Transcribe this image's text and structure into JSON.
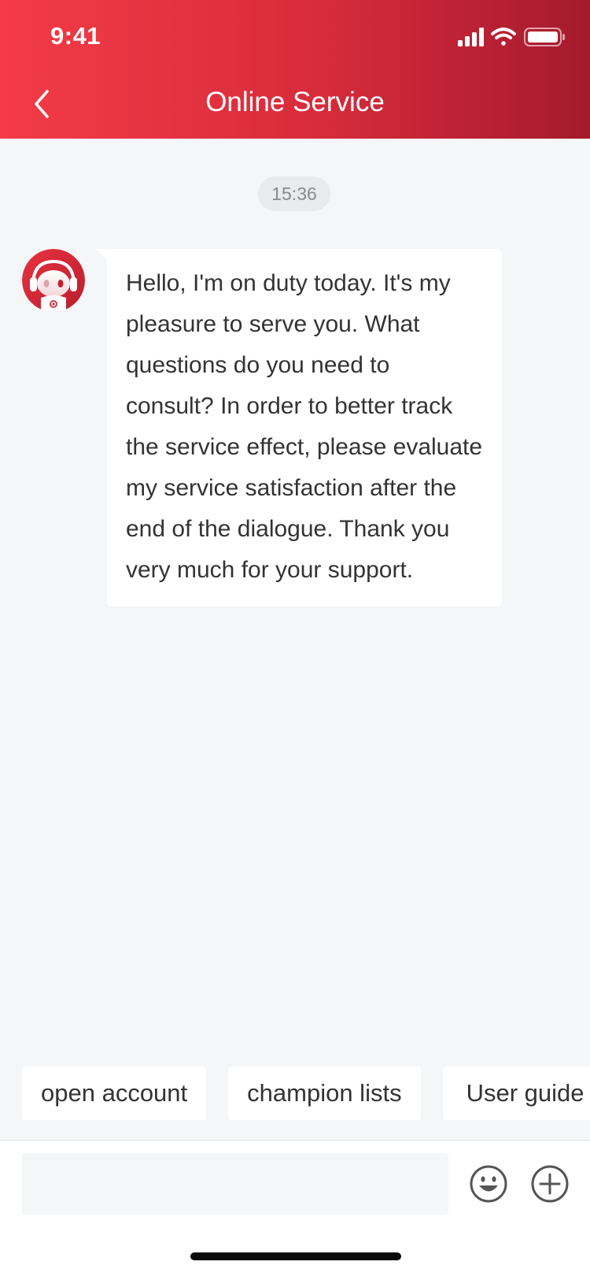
{
  "status_bar": {
    "time": "9:41"
  },
  "header": {
    "title": "Online Service"
  },
  "chat": {
    "timestamp": "15:36",
    "messages": [
      {
        "sender": "agent",
        "text": "Hello, I'm on duty today. It's my pleasure to serve you. What questions do you need to consult? In order to better track the service effect, please evaluate my service satisfaction after the end of the dialogue. Thank you very much for your support."
      }
    ]
  },
  "quick_replies": [
    {
      "label": "open account"
    },
    {
      "label": "champion lists"
    },
    {
      "label": "User guide"
    }
  ],
  "input": {
    "value": "",
    "placeholder": ""
  },
  "colors": {
    "header_start": "#f43b47",
    "header_end": "#a51a2e",
    "background": "#f5f6f8",
    "bubble": "#ffffff"
  },
  "icons": {
    "back": "chevron-left-icon",
    "emoji": "smiley-icon",
    "more": "plus-circle-icon"
  }
}
